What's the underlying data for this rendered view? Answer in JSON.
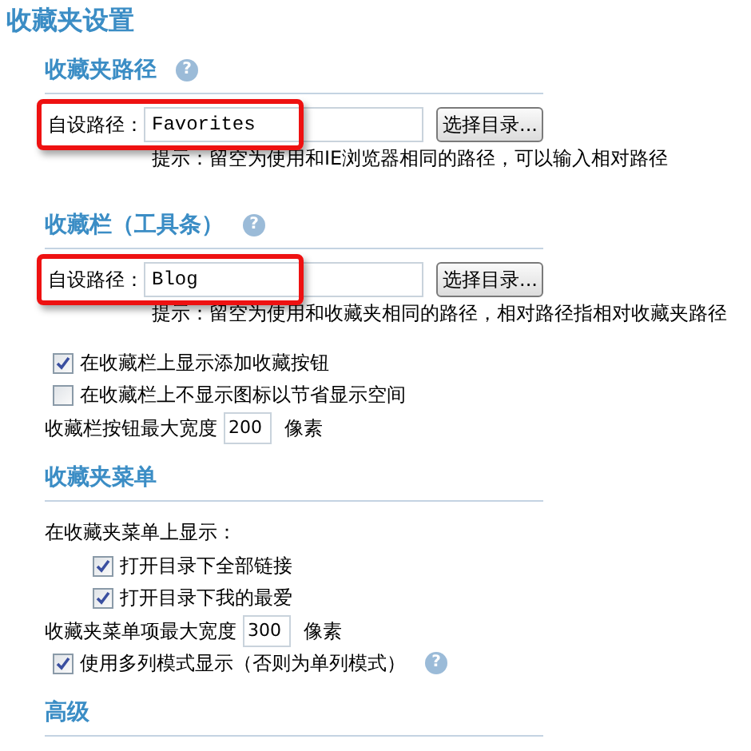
{
  "title": "收藏夹设置",
  "sections": [
    {
      "heading": "收藏夹路径",
      "help": "?",
      "items": [
        {
          "kind": "path",
          "label": "自设路径：",
          "value": "Favorites",
          "button": "选择目录...",
          "hint": "提示：留空为使用和IE浏览器相同的路径，可以输入相对路径",
          "highlighted": true
        }
      ]
    },
    {
      "heading": "收藏栏（工具条）",
      "help": "?",
      "items": [
        {
          "kind": "path",
          "label": "自设路径：",
          "value": "Blog",
          "button": "选择目录...",
          "hint": "提示：留空为使用和收藏夹相同的路径，相对路径指相对收藏夹路径",
          "highlighted": true
        },
        {
          "kind": "checkbox",
          "label": "在收藏栏上显示添加收藏按钮",
          "checked": true
        },
        {
          "kind": "checkbox",
          "label": "在收藏栏上不显示图标以节省显示空间",
          "checked": false
        },
        {
          "kind": "number",
          "label": "收藏栏按钮最大宽度",
          "value": "200",
          "unit": "像素"
        }
      ]
    },
    {
      "heading": "收藏夹菜单",
      "items": [
        {
          "kind": "text",
          "label": "在收藏夹菜单上显示：",
          "children": [
            {
              "kind": "checkbox",
              "label": "打开目录下全部链接",
              "checked": true
            },
            {
              "kind": "checkbox",
              "label": "打开目录下我的最爱",
              "checked": true
            }
          ]
        },
        {
          "kind": "number",
          "label": "收藏夹菜单项最大宽度",
          "value": "300",
          "unit": "像素"
        },
        {
          "kind": "checkbox",
          "label": "使用多列模式显示（否则为单列模式）",
          "checked": true,
          "help": "?"
        }
      ]
    },
    {
      "heading": "高级"
    }
  ]
}
